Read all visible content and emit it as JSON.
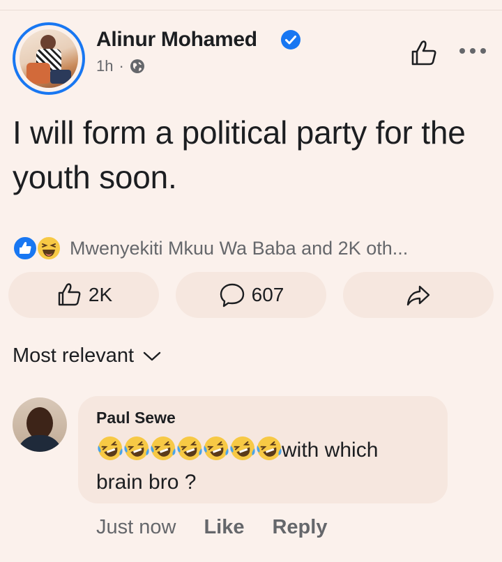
{
  "post": {
    "author": "Alinur Mohamed",
    "time": "1h",
    "separator": "·",
    "text": "I will form a political party for the youth soon.",
    "reactions_text": "Mwenyekiti Mkuu Wa Baba and 2K oth...",
    "like_count": "2K",
    "comment_count": "607"
  },
  "sort": {
    "label": "Most relevant"
  },
  "comment": {
    "author": "Paul Sewe",
    "text_tail": "with which",
    "text_line2": "brain bro ?",
    "emoji": [
      "rolling-laughing",
      "rolling-laughing",
      "rolling-laughing",
      "rolling-laughing",
      "rolling-laughing",
      "rolling-laughing",
      "rolling-laughing"
    ],
    "time": "Just now",
    "like_label": "Like",
    "reply_label": "Reply"
  },
  "colors": {
    "background": "#fbf1ec",
    "accent": "#1877f2",
    "button_bg": "#f6e7df",
    "muted_text": "#65676b"
  },
  "icons": [
    "verified-icon",
    "globe-icon",
    "thumbs-up-icon",
    "more-icon",
    "like-reaction-icon",
    "haha-reaction-icon",
    "comment-icon",
    "share-icon",
    "chevron-down-icon"
  ]
}
